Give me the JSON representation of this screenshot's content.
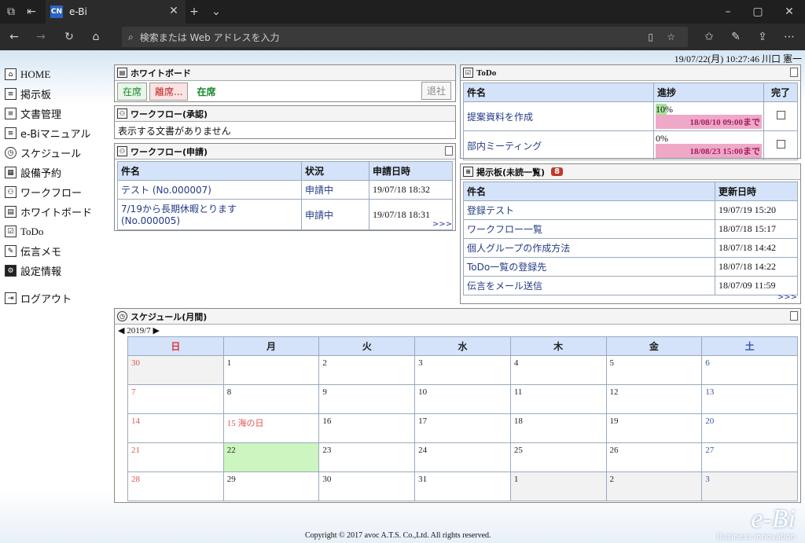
{
  "browser": {
    "tab_title": "e-Bi",
    "address_placeholder": "検索または Web アドレスを入力",
    "favicon_label": "CN"
  },
  "header": {
    "datetime": "19/07/22(月) 10:27:46",
    "user": "川口 憲一"
  },
  "sidebar": {
    "items": [
      {
        "label": "HOME"
      },
      {
        "label": "掲示板"
      },
      {
        "label": "文書管理"
      },
      {
        "label": "e-Biマニュアル"
      },
      {
        "label": "スケジュール"
      },
      {
        "label": "設備予約"
      },
      {
        "label": "ワークフロー"
      },
      {
        "label": "ホワイトボード"
      },
      {
        "label": "ToDo"
      },
      {
        "label": "伝言メモ"
      },
      {
        "label": "設定情報"
      }
    ],
    "logout": "ログアウト"
  },
  "whiteboard": {
    "title": "ホワイトボード",
    "btn_in": "在席",
    "btn_away": "離席...",
    "status": "在席",
    "btn_leave": "退社"
  },
  "wf_approve": {
    "title": "ワークフロー(承認)",
    "empty": "表示する文書がありません"
  },
  "wf_apply": {
    "title": "ワークフロー(申請)",
    "headers": [
      "件名",
      "状況",
      "申請日時"
    ],
    "rows": [
      [
        "テスト (No.000007)",
        "申請中",
        "19/07/18 18:32"
      ],
      [
        "7/19から長期休暇とります (No.000005)",
        "申請中",
        "19/07/18 18:31"
      ]
    ],
    "more": ">>>"
  },
  "todo": {
    "title": "ToDo",
    "headers": [
      "件名",
      "進捗",
      "完了"
    ],
    "rows": [
      {
        "name": "提案資料を作成",
        "pct": "10%",
        "progress": 0.1,
        "due": "18/08/10 09:00まで"
      },
      {
        "name": "部内ミーティング",
        "pct": "0%",
        "progress": 0,
        "due": "18/08/23 15:00まで"
      }
    ]
  },
  "board": {
    "title": "掲示板(未読一覧)",
    "badge": "8",
    "headers": [
      "件名",
      "更新日時"
    ],
    "rows": [
      [
        "登録テスト",
        "19/07/19 15:20"
      ],
      [
        "ワークフロー一覧",
        "18/07/18 15:17"
      ],
      [
        "個人グループの作成方法",
        "18/07/18 14:42"
      ],
      [
        "ToDo一覧の登録先",
        "18/07/18 14:22"
      ],
      [
        "伝言をメール送信",
        "18/07/09 11:59"
      ]
    ],
    "more": ">>>"
  },
  "schedule": {
    "title": "スケジュール(月間)",
    "month": "2019/7",
    "days": [
      "日",
      "月",
      "火",
      "水",
      "木",
      "金",
      "土"
    ],
    "weeks": [
      [
        "30",
        "1",
        "2",
        "3",
        "4",
        "5",
        "6"
      ],
      [
        "7",
        "8",
        "9",
        "10",
        "11",
        "12",
        "13"
      ],
      [
        "14",
        "15 海の日",
        "16",
        "17",
        "18",
        "19",
        "20"
      ],
      [
        "21",
        "22",
        "23",
        "24",
        "25",
        "26",
        "27"
      ],
      [
        "28",
        "29",
        "30",
        "31",
        "1",
        "2",
        "3"
      ]
    ]
  },
  "footer": {
    "copyright": "Copyright © 2017 avoc A.T.S. Co.,Ltd. All rights reserved.",
    "logo": "e-Bi",
    "logo_sub": "Business Innovation"
  },
  "colors": {
    "accent": "#d5e3fa",
    "due": "#f0a8c8",
    "today": "#ccf5c0",
    "link": "#243b86"
  }
}
